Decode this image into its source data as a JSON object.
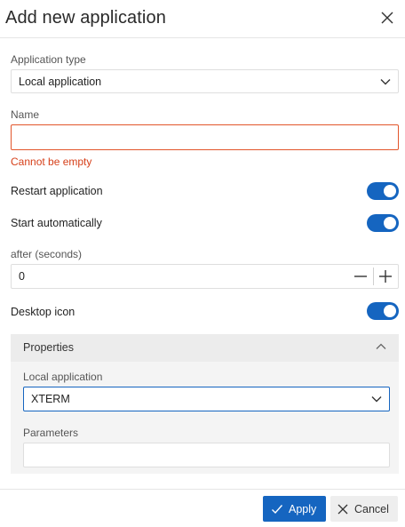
{
  "dialog": {
    "title": "Add new application",
    "close_icon": "close-icon"
  },
  "app_type": {
    "label": "Application type",
    "value": "Local application",
    "icon": "chevron-down-icon"
  },
  "name": {
    "label": "Name",
    "value": "",
    "error": "Cannot be empty",
    "error_color": "#e2552b"
  },
  "restart": {
    "label": "Restart application",
    "on": true
  },
  "autostart": {
    "label": "Start automatically",
    "on": true
  },
  "after_seconds": {
    "label": "after (seconds)",
    "value": "0",
    "decrement_icon": "minus-icon",
    "increment_icon": "plus-icon"
  },
  "desktop_icon": {
    "label": "Desktop icon",
    "on": true
  },
  "properties": {
    "title": "Properties",
    "icon": "chevron-up-icon",
    "local_app": {
      "label": "Local application",
      "value": "XTERM",
      "icon": "chevron-down-icon"
    },
    "parameters": {
      "label": "Parameters",
      "value": ""
    }
  },
  "footer": {
    "apply_label": "Apply",
    "apply_icon": "check-icon",
    "cancel_label": "Cancel",
    "cancel_icon": "close-icon"
  },
  "colors": {
    "accent": "#1565c0",
    "error": "#e2552b"
  }
}
